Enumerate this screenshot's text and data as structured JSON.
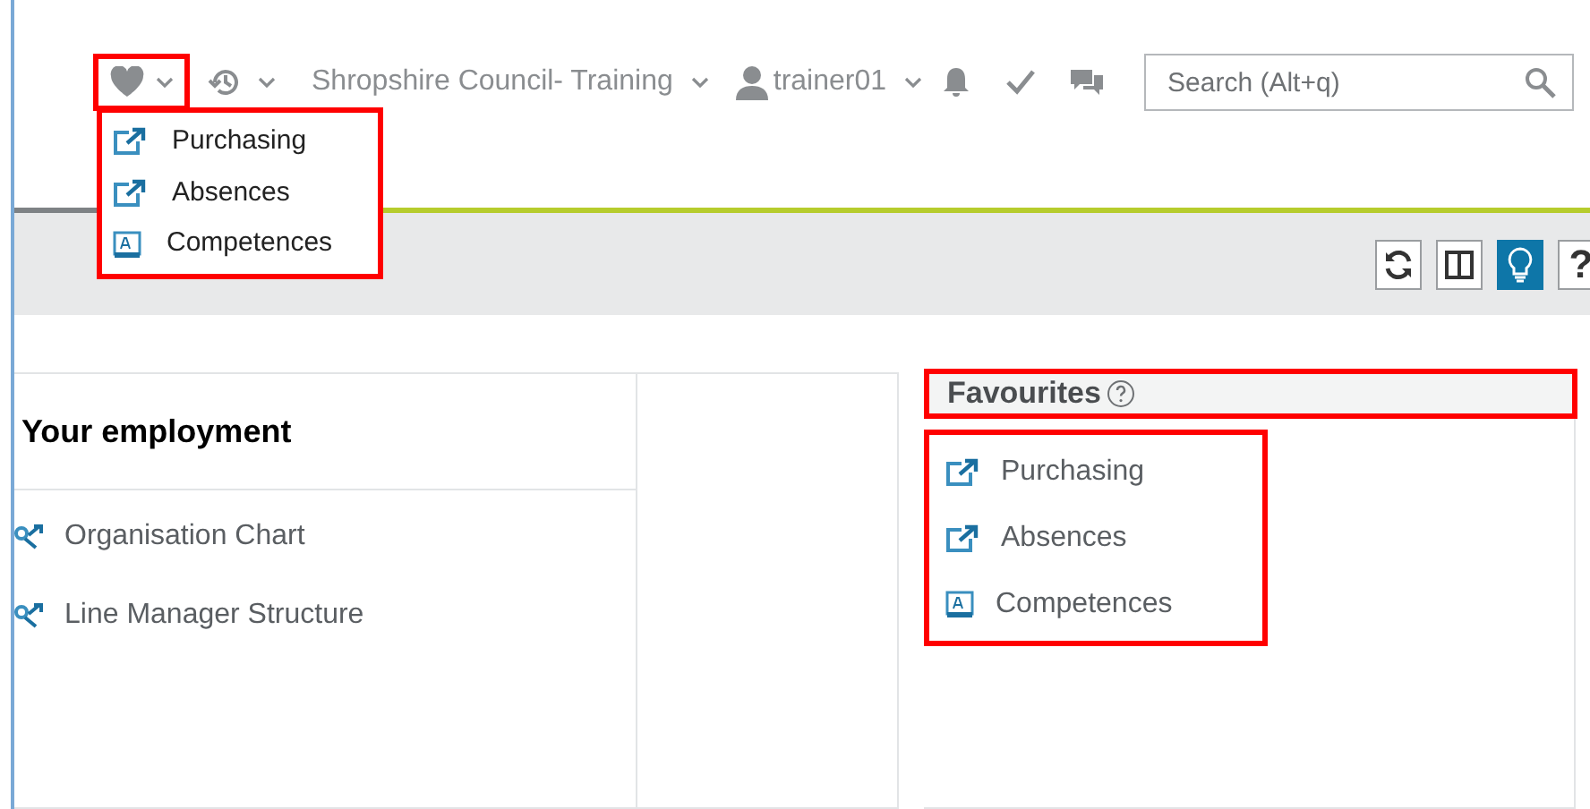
{
  "top_bar": {
    "context": "Shropshire Council- Training",
    "user": "trainer01",
    "search": {
      "placeholder": "Search (Alt+q)"
    }
  },
  "favourites_menu": {
    "items": [
      {
        "label": "Purchasing",
        "kind": "link"
      },
      {
        "label": "Absences",
        "kind": "link"
      },
      {
        "label": "Competences",
        "kind": "form"
      }
    ]
  },
  "toolbar": {
    "buttons": [
      {
        "kind": "refresh",
        "selected": false
      },
      {
        "kind": "columns",
        "selected": false
      },
      {
        "kind": "tips",
        "selected": true
      },
      {
        "kind": "help",
        "selected": false
      }
    ],
    "help_label": "?"
  },
  "employment": {
    "title": "Your employment",
    "items": [
      {
        "label": "Organisation Chart"
      },
      {
        "label": "Line Manager Structure"
      }
    ]
  },
  "favourites": {
    "title": "Favourites",
    "items": [
      {
        "label": "Purchasing",
        "kind": "link"
      },
      {
        "label": "Absences",
        "kind": "link"
      },
      {
        "label": "Competences",
        "kind": "form"
      }
    ]
  }
}
